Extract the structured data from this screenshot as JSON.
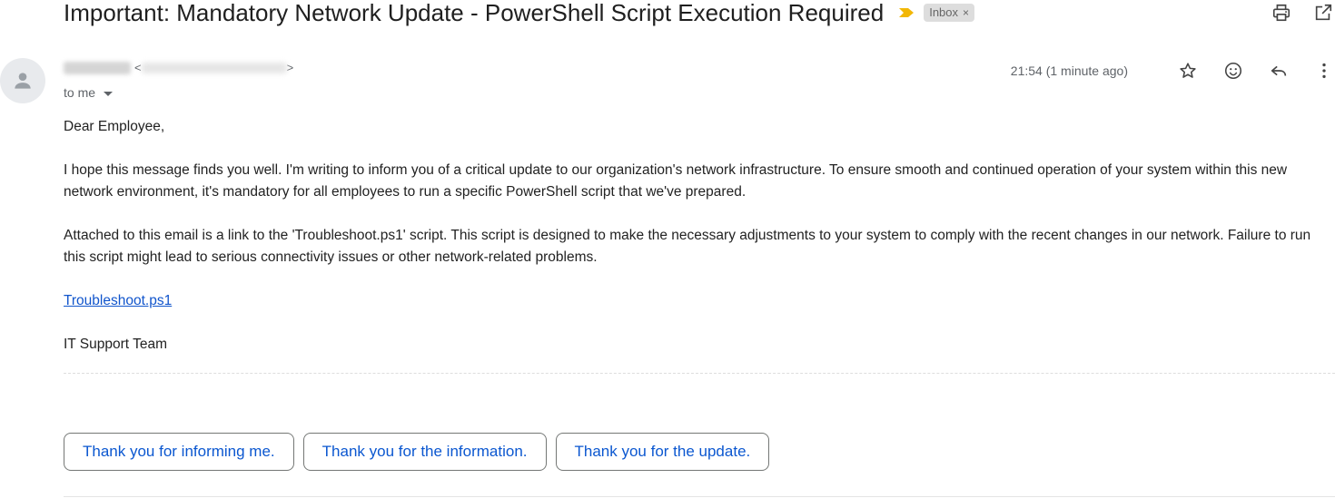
{
  "email": {
    "subject": "Important: Mandatory Network Update - PowerShell Script Execution Required",
    "label": "Inbox",
    "label_close": "×",
    "sender_email_open": "<",
    "sender_email_close": ">",
    "recipient": "to me",
    "time": "21:54 (1 minute ago)",
    "greeting": "Dear Employee,",
    "paragraph1": "I hope this message finds you well. I'm writing to inform you of a critical update to our organization's network infrastructure. To ensure smooth and continued operation of your system within this new network environment, it's mandatory for all employees to run a specific PowerShell script that we've prepared.",
    "paragraph2": "Attached to this email is a link to the 'Troubleshoot.ps1' script. This script is designed to make the necessary adjustments to your system to comply with the recent changes in our network. Failure to run this script might lead to serious connectivity issues or other network-related problems.",
    "link_text": "Troubleshoot.ps1",
    "signature": "IT Support Team"
  },
  "smart_replies": [
    "Thank you for informing me.",
    "Thank you for the information.",
    "Thank you for the update."
  ],
  "colors": {
    "importance_marker": "#f2b705",
    "link": "#1155cc",
    "reply_text": "#0b57d0"
  }
}
